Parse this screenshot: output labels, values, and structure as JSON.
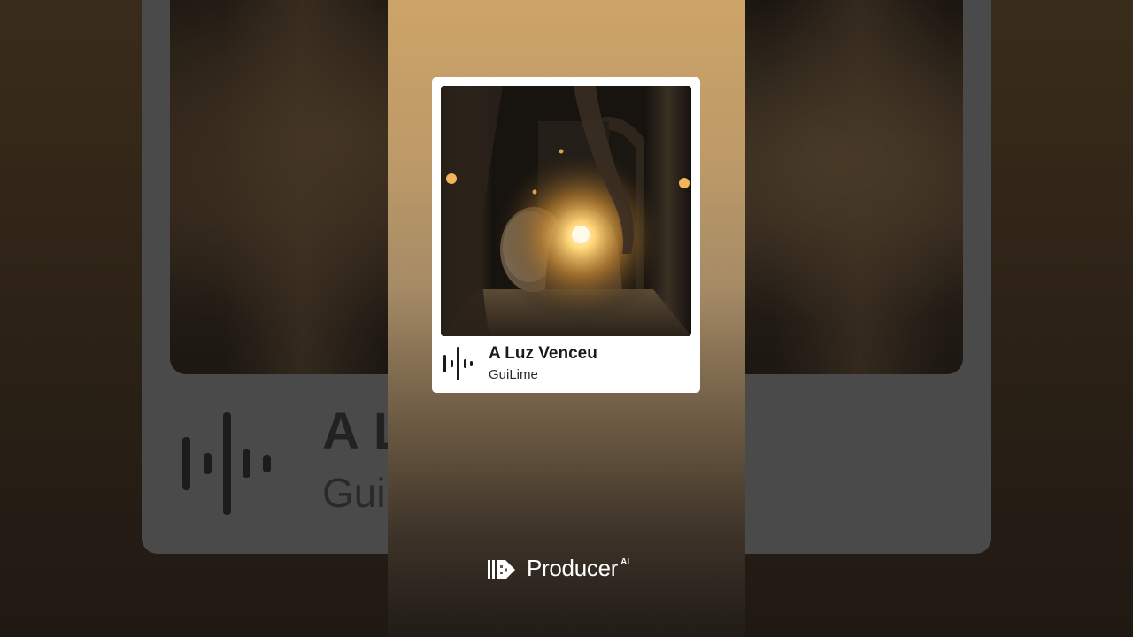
{
  "track": {
    "title": "A Luz Venceu",
    "artist": "GuiLime"
  },
  "background": {
    "title_fragment": "A L",
    "artist_fragment": "Gui"
  },
  "brand": {
    "name": "Producer",
    "superscript": "AI"
  },
  "colors": {
    "panel_top": "#cda468",
    "panel_bottom": "#211c17",
    "card_bg": "#ffffff",
    "title_text": "#1a1a1a"
  },
  "icons": {
    "audio_wave": "audio-waveform-icon",
    "brand_logo": "producer-logo-icon"
  }
}
